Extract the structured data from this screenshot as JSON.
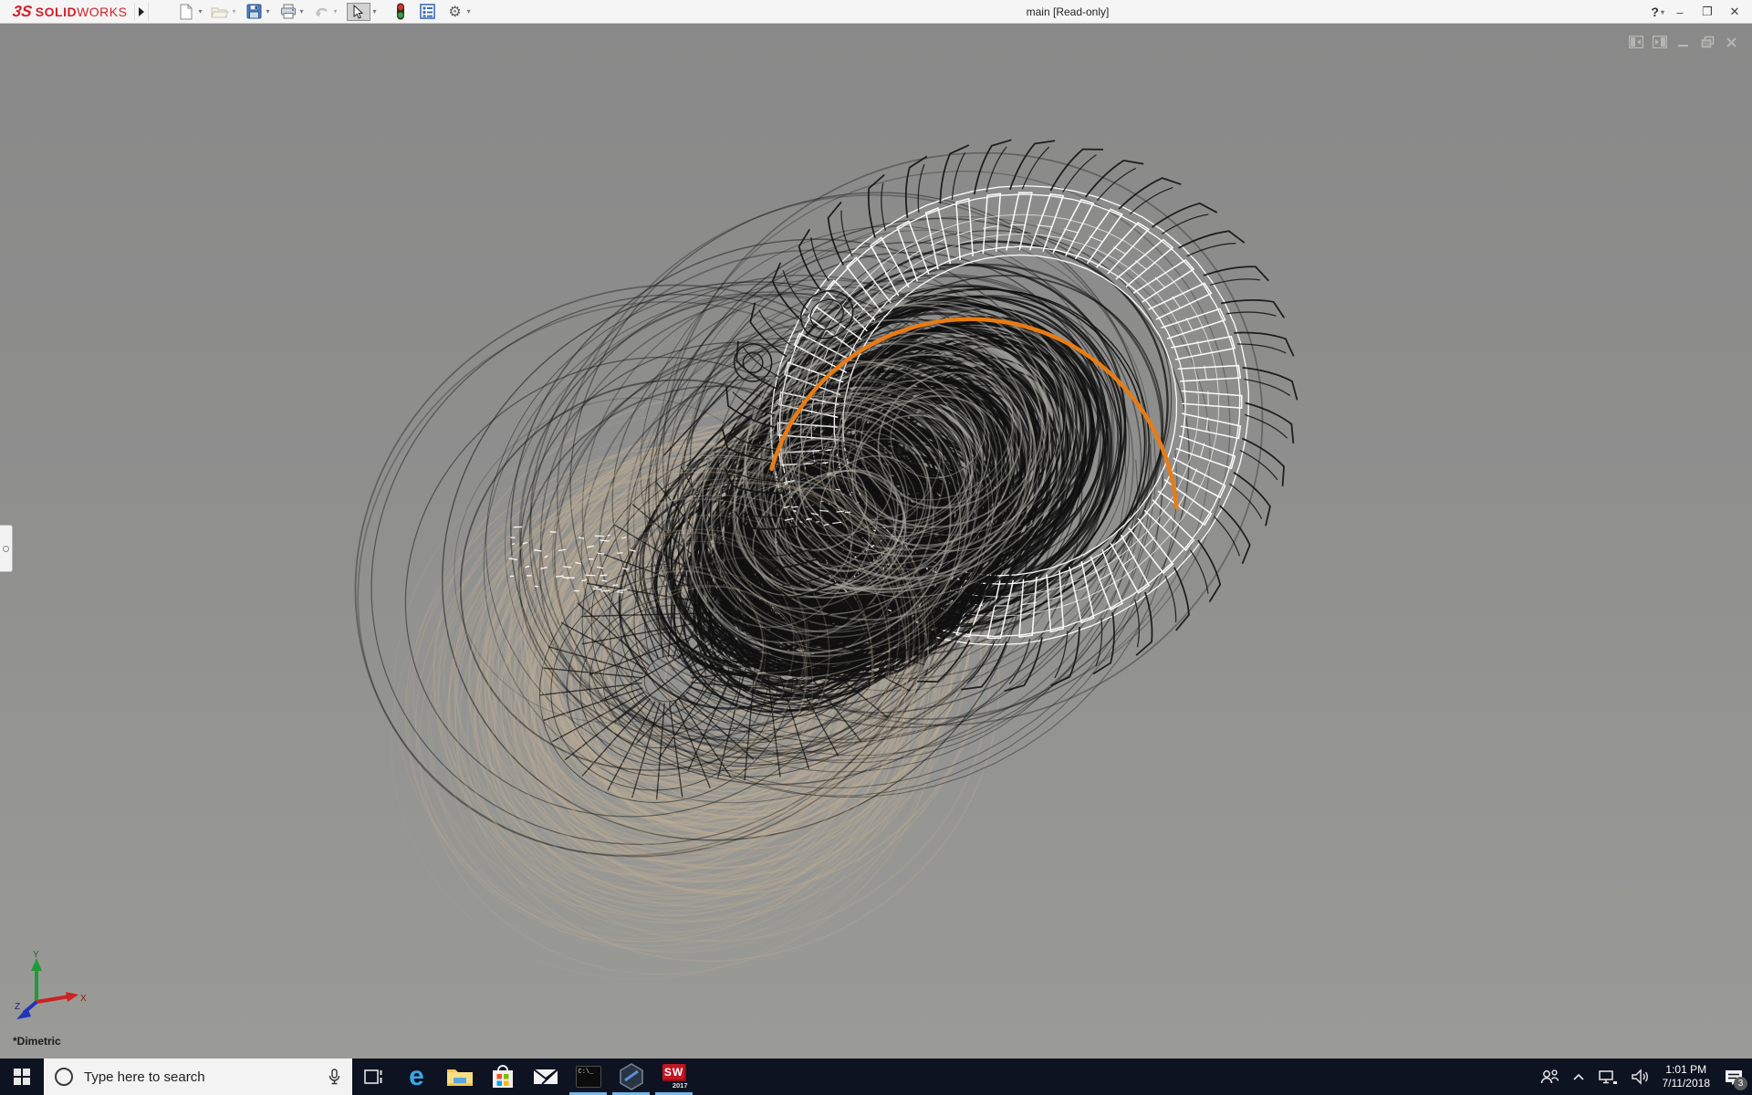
{
  "titlebar": {
    "logo_3s": "3S",
    "logo_solid": "SOLID",
    "logo_works": "WORKS",
    "title": "main [Read-only]",
    "help_label": "?",
    "window": {
      "minimize": "–",
      "restore": "❐",
      "close": "✕"
    },
    "toolbar_icons": [
      "new-document",
      "open-document",
      "save",
      "print",
      "undo",
      "select-tool",
      "display-states",
      "feature-list",
      "settings-gear"
    ]
  },
  "doc_window_controls": [
    "expand-left-panel",
    "expand-right-panel",
    "minimize",
    "restore",
    "close"
  ],
  "viewport": {
    "view_label": "*Dimetric",
    "triad": {
      "x_label": "X",
      "y_label": "Y",
      "z_label": "Z",
      "x_color": "#cc2222",
      "y_color": "#1f9b3a",
      "z_color": "#2233bb"
    }
  },
  "model_colors": {
    "background_top": "#898989",
    "background_bottom": "#9a9a96",
    "wire_black": "#101010",
    "wire_white": "#ffffff",
    "wire_tan": "#b9ab94",
    "wire_gray": "#a8a59d",
    "highlight_orange": "#e87c14"
  },
  "taskbar": {
    "search_placeholder": "Type here to search",
    "icons": [
      {
        "name": "task-view"
      },
      {
        "name": "edge-browser",
        "glyph": "e"
      },
      {
        "name": "file-explorer"
      },
      {
        "name": "microsoft-store"
      },
      {
        "name": "mail"
      },
      {
        "name": "command-prompt",
        "label": "C:\\_"
      },
      {
        "name": "hexagon-app"
      },
      {
        "name": "solidworks-2017",
        "label": "SW",
        "sublabel": "2017"
      }
    ],
    "active_apps": [
      "command-prompt",
      "hexagon-app",
      "solidworks-2017"
    ],
    "accent_underline": "#76b9ed",
    "tray": {
      "time": "1:01 PM",
      "date": "7/11/2018",
      "badge_count": "3"
    }
  }
}
